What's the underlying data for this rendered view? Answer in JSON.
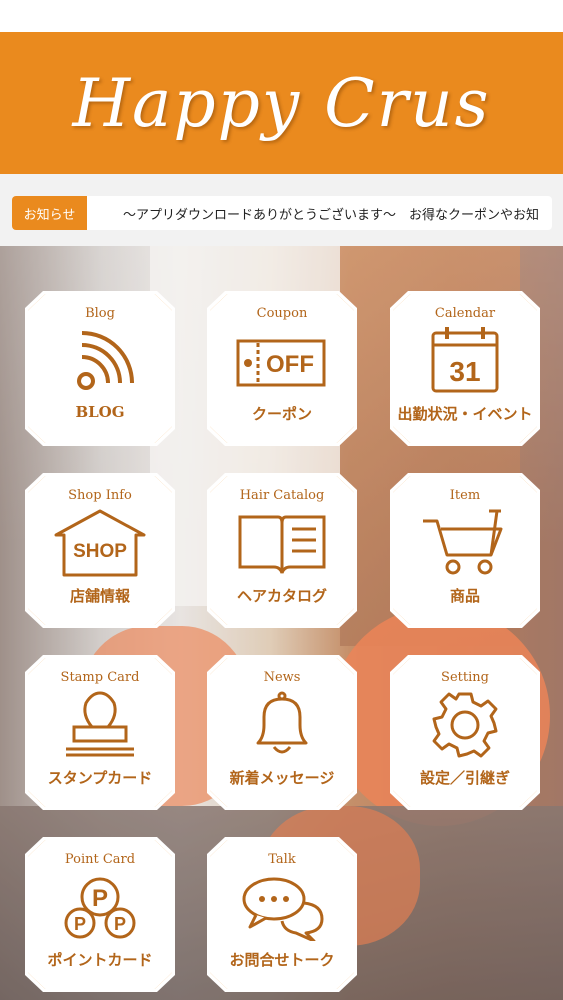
{
  "header": {
    "title": "Happy Crus"
  },
  "news": {
    "label": "お知らせ",
    "text": "〜アプリダウンロードありがとうございます〜　お得なクーポンやお知"
  },
  "colors": {
    "accent": "#ea8a1e",
    "tile_text": "#b2651a"
  },
  "menu": [
    {
      "en": "Blog",
      "jp": "BLOG",
      "icon": "rss-icon"
    },
    {
      "en": "Coupon",
      "jp": "クーポン",
      "icon": "coupon-icon",
      "icon_text": "OFF"
    },
    {
      "en": "Calendar",
      "jp": "出勤状況・イベント",
      "icon": "calendar-icon",
      "icon_text": "31"
    },
    {
      "en": "Shop Info",
      "jp": "店舗情報",
      "icon": "shop-icon",
      "icon_text": "SHOP"
    },
    {
      "en": "Hair Catalog",
      "jp": "ヘアカタログ",
      "icon": "book-icon"
    },
    {
      "en": "Item",
      "jp": "商品",
      "icon": "cart-icon"
    },
    {
      "en": "Stamp Card",
      "jp": "スタンプカード",
      "icon": "stamp-icon"
    },
    {
      "en": "News",
      "jp": "新着メッセージ",
      "icon": "bell-icon"
    },
    {
      "en": "Setting",
      "jp": "設定／引継ぎ",
      "icon": "gear-icon"
    },
    {
      "en": "Point Card",
      "jp": "ポイントカード",
      "icon": "points-icon",
      "icon_text": "P"
    },
    {
      "en": "Talk",
      "jp": "お問合せトーク",
      "icon": "chat-icon"
    }
  ]
}
